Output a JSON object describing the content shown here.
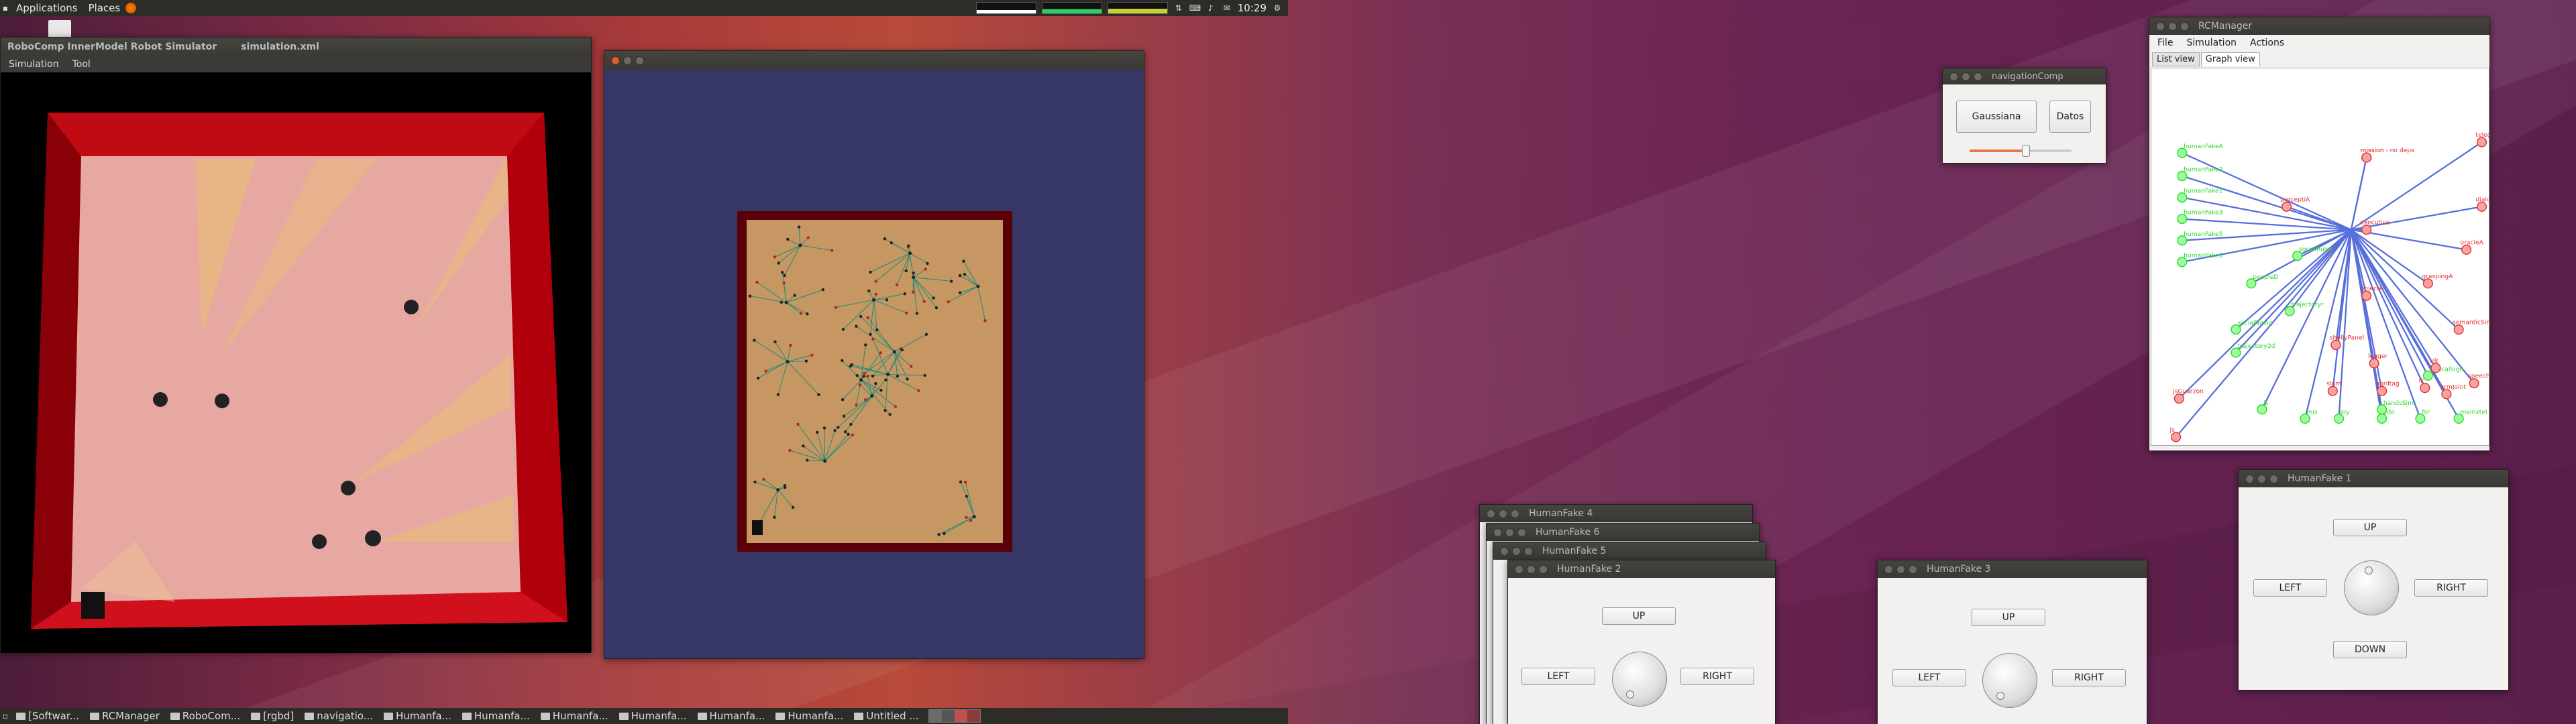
{
  "top_panel": {
    "applications": "Applications",
    "places": "Places",
    "clock": "10:29"
  },
  "innermodel_window": {
    "title": "RoboComp InnerModel Robot Simulator",
    "file": "simulation.xml",
    "menu": [
      "Simulation",
      "Tool"
    ]
  },
  "navigation_window": {
    "title": "navigationComp",
    "gaussiana": "Gaussiana",
    "datos": "Datos",
    "slider_fraction": 0.55
  },
  "rcmanager_window": {
    "title": "RCManager",
    "menu": [
      "File",
      "Simulation",
      "Actions"
    ],
    "tabs": [
      "List view",
      "Graph view"
    ],
    "graph_green": [
      "humanFakeA",
      "humanFake2",
      "humanFake1",
      "humanFake3",
      "humanFake5",
      "humanFake6",
      "socialNavig...",
      "trajectory2d",
      "peopleD",
      "socialRules",
      "trajectoryr",
      "js",
      "mis",
      "joy",
      "vdo",
      "fsr",
      "mainxtel",
      "handsSim",
      "opticalSign"
    ],
    "graph_red": [
      "mission - no deps",
      "mission",
      "telegram",
      "dialogA",
      "perceptiA",
      "executive",
      "oracleA",
      "graspingA",
      "objectA",
      "semanticSimil",
      "shellyPanel",
      "logger",
      "vik",
      "speech",
      "jsGuarzon",
      "slam",
      "apriltag",
      "armJoint",
      "js",
      "ik"
    ]
  },
  "humanfake_windows": [
    {
      "title": "HumanFake 4"
    },
    {
      "title": "HumanFake 6"
    },
    {
      "title": "HumanFake 5"
    },
    {
      "title": "HumanFake 2",
      "up": "UP",
      "left": "LEFT",
      "right": "RIGHT"
    },
    {
      "title": "HumanFake 3",
      "up": "UP",
      "left": "LEFT",
      "right": "RIGHT"
    },
    {
      "title": "HumanFake 1",
      "up": "UP",
      "left": "LEFT",
      "right": "RIGHT",
      "down": "DOWN"
    }
  ],
  "taskbar": [
    {
      "label": "[Softwar..."
    },
    {
      "label": "RCManager"
    },
    {
      "label": "RoboCom..."
    },
    {
      "label": "[rgbd]"
    },
    {
      "label": "navigatio..."
    },
    {
      "label": "Humanfa..."
    },
    {
      "label": "Humanfa..."
    },
    {
      "label": "Humanfa..."
    },
    {
      "label": "Humanfa..."
    },
    {
      "label": "Humanfa..."
    },
    {
      "label": "Humanfa..."
    },
    {
      "label": "Untitled ..."
    }
  ],
  "colors": {
    "panel": "#2d2c29",
    "sim_floor": "#e0a39c",
    "nav_bg": "#363667",
    "map": "#c69762",
    "green_node": "#2bd52b",
    "red_node": "#e03030",
    "edge": "#2040d0"
  }
}
